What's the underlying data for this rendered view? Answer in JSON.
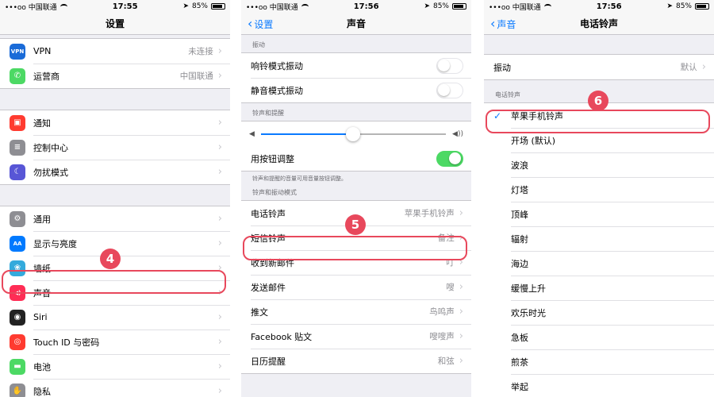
{
  "status_bar": {
    "carrier": "•••oo 中国联通",
    "battery": "85%",
    "time_p1": "17:55",
    "time_p2": "17:56",
    "time_p3": "17:56"
  },
  "colors": {
    "accent": "#0a7aff",
    "highlight": "#e8485c",
    "toggle_on": "#4cd964"
  },
  "settings": {
    "title": "设置",
    "groups": [
      [
        {
          "label": "VPN",
          "value": "未连接",
          "icon": "vpn-icon",
          "icon_text": "VPN",
          "color": "#1a6bd8"
        },
        {
          "label": "运营商",
          "value": "中国联通",
          "icon": "phone-icon",
          "icon_text": "✆",
          "color": "#4cd964"
        }
      ],
      [
        {
          "label": "通知",
          "value": "",
          "icon": "notifications-icon",
          "icon_text": "▣",
          "color": "#ff3b30"
        },
        {
          "label": "控制中心",
          "value": "",
          "icon": "control-center-icon",
          "icon_text": "≡",
          "color": "#8e8e93"
        },
        {
          "label": "勿扰模式",
          "value": "",
          "icon": "moon-icon",
          "icon_text": "☾",
          "color": "#5856d6"
        }
      ],
      [
        {
          "label": "通用",
          "value": "",
          "icon": "gear-icon",
          "icon_text": "⚙",
          "color": "#8e8e93"
        },
        {
          "label": "显示与亮度",
          "value": "",
          "icon": "display-icon",
          "icon_text": "AA",
          "color": "#007aff"
        },
        {
          "label": "墙纸",
          "value": "",
          "icon": "wallpaper-icon",
          "icon_text": "❀",
          "color": "#34aadc"
        },
        {
          "label": "声音",
          "value": "",
          "icon": "speaker-icon",
          "icon_text": "◀)",
          "color": "#ff2d55"
        },
        {
          "label": "Siri",
          "value": "",
          "icon": "siri-icon",
          "icon_text": "◉",
          "color": "#222222"
        },
        {
          "label": "Touch ID 与密码",
          "value": "",
          "icon": "fingerprint-icon",
          "icon_text": "◎",
          "color": "#ff3b30"
        },
        {
          "label": "电池",
          "value": "",
          "icon": "battery-icon",
          "icon_text": "▬",
          "color": "#4cd964"
        },
        {
          "label": "隐私",
          "value": "",
          "icon": "hand-icon",
          "icon_text": "✋",
          "color": "#8e8e93"
        }
      ]
    ]
  },
  "sounds": {
    "back_label": "设置",
    "title": "声音",
    "vibrate_header": "振动",
    "vibrate_on_ring": "响铃模式振动",
    "vibrate_on_silent": "静音模式振动",
    "ringer_header": "铃声和提醒",
    "ringer_level": 0.5,
    "change_with_buttons": "用按钮调整",
    "change_with_buttons_on": true,
    "ringer_footer": "铃声和提醒的音量可用音量按钮调整。",
    "patterns_header": "铃声和振动模式",
    "patterns": [
      {
        "label": "电话铃声",
        "value": "苹果手机铃声"
      },
      {
        "label": "短信铃声",
        "value": "备注"
      },
      {
        "label": "收到新邮件",
        "value": "叮"
      },
      {
        "label": "发送邮件",
        "value": "嗖"
      },
      {
        "label": "推文",
        "value": "鸟鸣声"
      },
      {
        "label": "Facebook 贴文",
        "value": "嗖嗖声"
      },
      {
        "label": "日历提醒",
        "value": "和弦"
      }
    ]
  },
  "ringtone": {
    "back_label": "声音",
    "title": "电话铃声",
    "vibration_label": "振动",
    "vibration_value": "默认",
    "header": "电话铃声",
    "tones": [
      "苹果手机铃声",
      "开场 (默认)",
      "波浪",
      "灯塔",
      "顶峰",
      "辐射",
      "海边",
      "缓慢上升",
      "欢乐时光",
      "急板",
      "煎茶",
      "举起"
    ],
    "selected_index": 0
  },
  "badges": {
    "step4": "4",
    "step5": "5",
    "step6": "6"
  }
}
